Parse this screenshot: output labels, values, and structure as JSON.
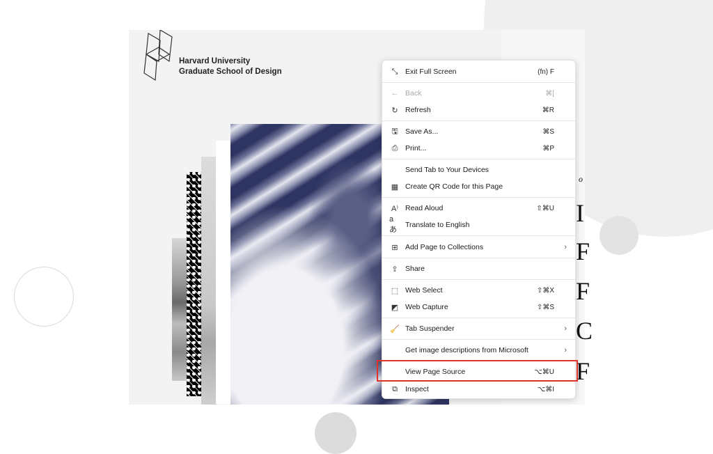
{
  "background": {
    "accent_highlight_color": "#e0322b"
  },
  "site": {
    "brand_line1": "Harvard University",
    "brand_line2": "Graduate School of Design",
    "partial_text_right": "o",
    "partial_letters": [
      "I",
      "F",
      "F",
      "C",
      "F"
    ]
  },
  "context_menu": {
    "items": [
      {
        "icon": "exit-fullscreen-icon",
        "glyph": "⤡",
        "label": "Exit Full Screen",
        "shortcut": "(fn) F",
        "disabled": false,
        "submenu": false
      },
      {
        "icon": "back-arrow-icon",
        "glyph": "←",
        "label": "Back",
        "shortcut": "⌘[",
        "disabled": true,
        "submenu": false
      },
      {
        "icon": "refresh-icon",
        "glyph": "↻",
        "label": "Refresh",
        "shortcut": "⌘R",
        "disabled": false,
        "submenu": false
      },
      {
        "icon": "save-as-icon",
        "glyph": "🖫",
        "label": "Save As...",
        "shortcut": "⌘S",
        "disabled": false,
        "submenu": false
      },
      {
        "icon": "print-icon",
        "glyph": "⎙",
        "label": "Print...",
        "shortcut": "⌘P",
        "disabled": false,
        "submenu": false
      },
      {
        "icon": "",
        "glyph": "",
        "label": "Send Tab to Your Devices",
        "shortcut": "",
        "disabled": false,
        "submenu": false
      },
      {
        "icon": "qr-code-icon",
        "glyph": "▦",
        "label": "Create QR Code for this Page",
        "shortcut": "",
        "disabled": false,
        "submenu": false
      },
      {
        "icon": "read-aloud-icon",
        "glyph": "A⁾",
        "label": "Read Aloud",
        "shortcut": "⇧⌘U",
        "disabled": false,
        "submenu": false
      },
      {
        "icon": "translate-icon",
        "glyph": "aあ",
        "label": "Translate to English",
        "shortcut": "",
        "disabled": false,
        "submenu": false
      },
      {
        "icon": "collections-icon",
        "glyph": "⊞",
        "label": "Add Page to Collections",
        "shortcut": "",
        "disabled": false,
        "submenu": true
      },
      {
        "icon": "share-icon",
        "glyph": "⇪",
        "label": "Share",
        "shortcut": "",
        "disabled": false,
        "submenu": false
      },
      {
        "icon": "web-select-icon",
        "glyph": "⬚",
        "label": "Web Select",
        "shortcut": "⇧⌘X",
        "disabled": false,
        "submenu": false
      },
      {
        "icon": "web-capture-icon",
        "glyph": "◩",
        "label": "Web Capture",
        "shortcut": "⇧⌘S",
        "disabled": false,
        "submenu": false
      },
      {
        "icon": "broom-icon",
        "glyph": "🧹",
        "label": "Tab Suspender",
        "shortcut": "",
        "disabled": false,
        "submenu": true
      },
      {
        "icon": "",
        "glyph": "",
        "label": "Get image descriptions from Microsoft",
        "shortcut": "",
        "disabled": false,
        "submenu": true
      },
      {
        "icon": "",
        "glyph": "",
        "label": "View Page Source",
        "shortcut": "⌥⌘U",
        "disabled": false,
        "submenu": false
      },
      {
        "icon": "inspect-icon",
        "glyph": "⧉",
        "label": "Inspect",
        "shortcut": "⌥⌘I",
        "disabled": false,
        "submenu": false
      }
    ],
    "submenu_glyph": "›",
    "highlighted_item": "View Page Source"
  }
}
